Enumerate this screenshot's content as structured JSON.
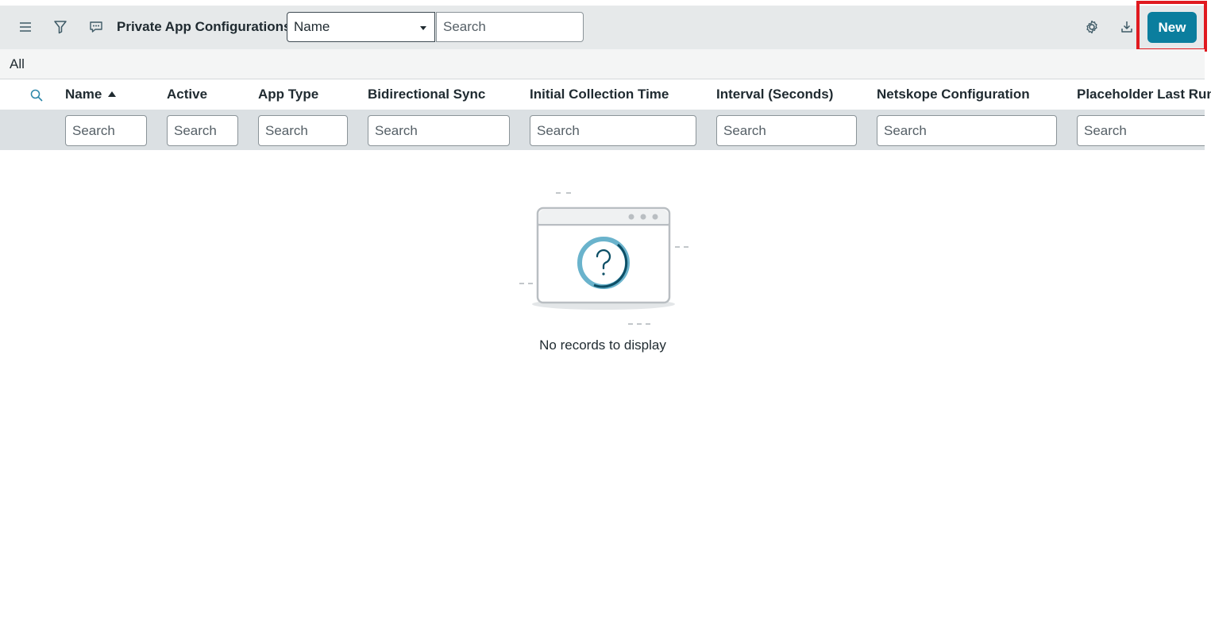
{
  "header": {
    "title": "Private App Configurations",
    "field_select": "Name",
    "search_placeholder": "Search",
    "new_label": "New",
    "icons": [
      "menu-icon",
      "filter-icon",
      "comment-icon",
      "gear-icon",
      "download-icon"
    ]
  },
  "breadcrumb": "All",
  "columns": [
    {
      "label": "Name",
      "sorted": "ascending"
    },
    {
      "label": "Active"
    },
    {
      "label": "App Type"
    },
    {
      "label": "Bidirectional Sync"
    },
    {
      "label": "Initial Collection Time"
    },
    {
      "label": "Interval (Seconds)"
    },
    {
      "label": "Netskope Configuration"
    },
    {
      "label": "Placeholder Last Run"
    }
  ],
  "column_search_placeholder": "Search",
  "empty_message": "No records to display",
  "colors": {
    "accent": "#0b7e9e",
    "highlight_border": "#e0191f",
    "header_bg": "#e6e9ea",
    "filter_row_bg": "#dbe0e3"
  }
}
